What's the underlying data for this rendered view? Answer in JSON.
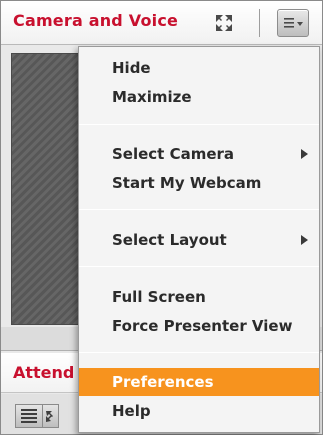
{
  "camera_pod": {
    "title": "Camera and Voice",
    "icons": {
      "fullscreen": "fullscreen-toggle-icon",
      "options": "pod-options-menu-icon"
    }
  },
  "attendees_pod": {
    "title": "Attend",
    "icons": {
      "list_view": "list-view-icon",
      "grid_view": "grid-view-icon"
    }
  },
  "menu": {
    "items": [
      {
        "label": "Hide"
      },
      {
        "label": "Maximize"
      },
      {
        "label": "Select Camera",
        "submenu": true
      },
      {
        "label": "Start My Webcam"
      },
      {
        "label": "Select Layout",
        "submenu": true
      },
      {
        "label": "Full Screen"
      },
      {
        "label": "Force Presenter View"
      },
      {
        "label": "Preferences",
        "highlighted": true
      },
      {
        "label": "Help"
      }
    ]
  },
  "colors": {
    "title_red": "#c8102e",
    "highlight_orange": "#f7931e",
    "menu_background": "#f4f4f4"
  }
}
